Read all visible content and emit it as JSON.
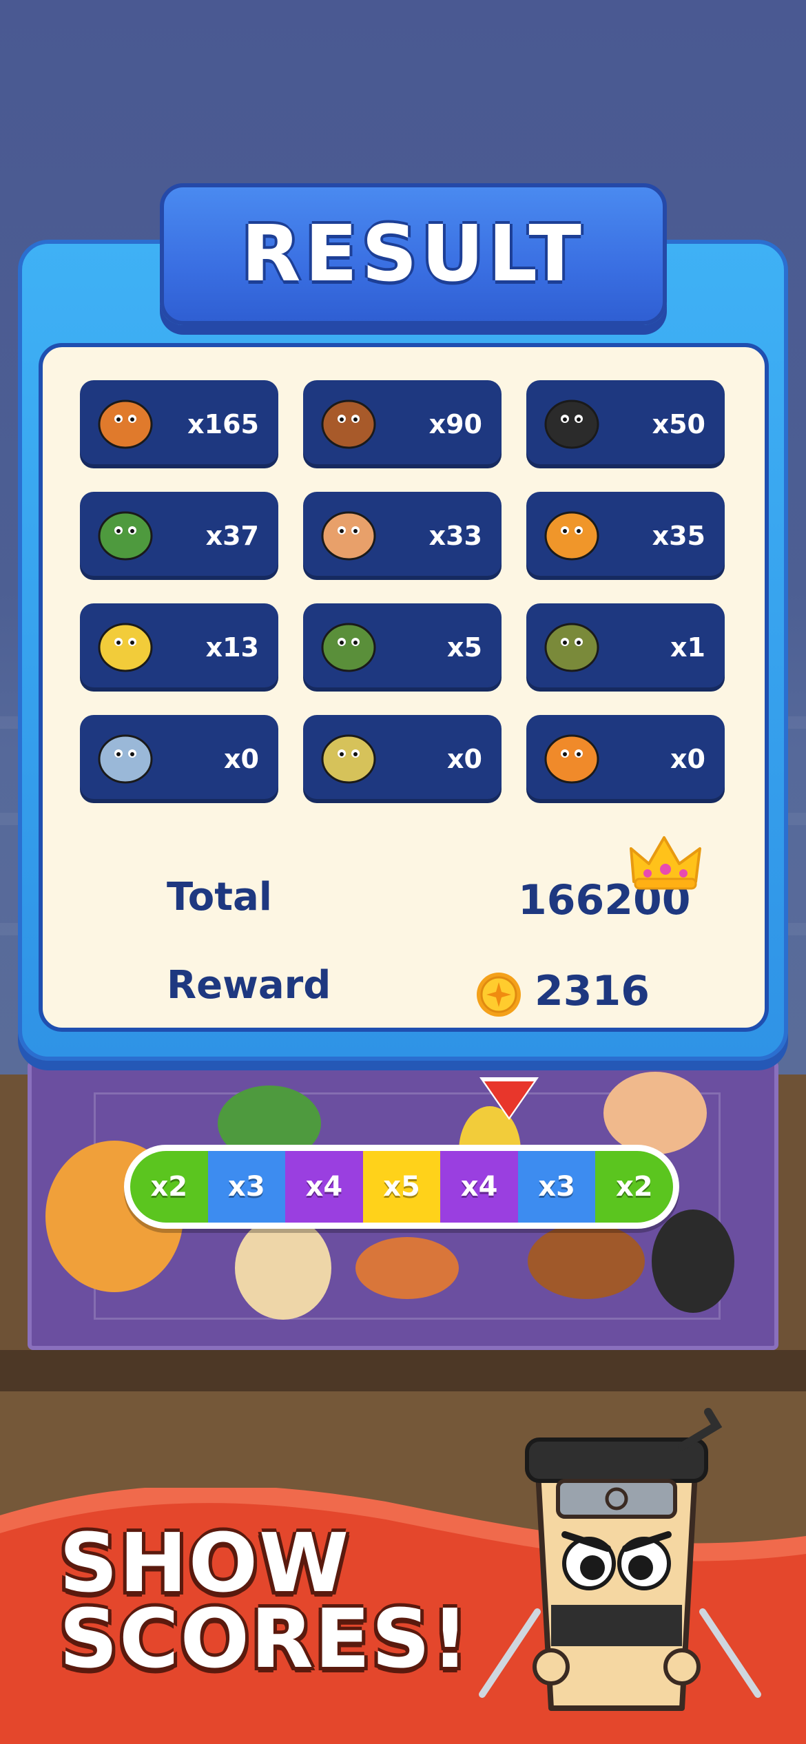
{
  "result": {
    "title": "RESULT",
    "items": [
      {
        "icon": "fish-cat-icon",
        "count": "x165"
      },
      {
        "icon": "capybara-icon",
        "count": "x90"
      },
      {
        "icon": "ninja-cup-icon",
        "count": "x50"
      },
      {
        "icon": "frog-tire-icon",
        "count": "x37"
      },
      {
        "icon": "cup-ballerina-icon",
        "count": "x33"
      },
      {
        "icon": "orange-muscle-icon",
        "count": "x35"
      },
      {
        "icon": "banana-monkey-icon",
        "count": "x13"
      },
      {
        "icon": "cactus-elephant-icon",
        "count": "x5"
      },
      {
        "icon": "tree-man-icon",
        "count": "x1"
      },
      {
        "icon": "shark-sneakers-icon",
        "count": "x0"
      },
      {
        "icon": "crocodile-plane-icon",
        "count": "x0"
      },
      {
        "icon": "wooden-stick-man-icon",
        "count": "x0"
      }
    ],
    "total_label": "Total",
    "total_value": "166200",
    "reward_label": "Reward",
    "reward_value": "2316"
  },
  "multiplier_bar": {
    "cells": [
      {
        "label": "x2",
        "color": "#5bc51f"
      },
      {
        "label": "x3",
        "color": "#3d8cf0"
      },
      {
        "label": "x4",
        "color": "#9a3fe0"
      },
      {
        "label": "x5",
        "color": "#ffd21a"
      },
      {
        "label": "x4",
        "color": "#9a3fe0"
      },
      {
        "label": "x3",
        "color": "#3d8cf0"
      },
      {
        "label": "x2",
        "color": "#5bc51f"
      }
    ]
  },
  "promo": {
    "line1": "SHOW",
    "line2": "SCORES!"
  },
  "colors": {
    "panel": "#3fb1f5",
    "tile": "#1e3880",
    "card": "#fdf6e3",
    "accent_red": "#e8362b"
  }
}
